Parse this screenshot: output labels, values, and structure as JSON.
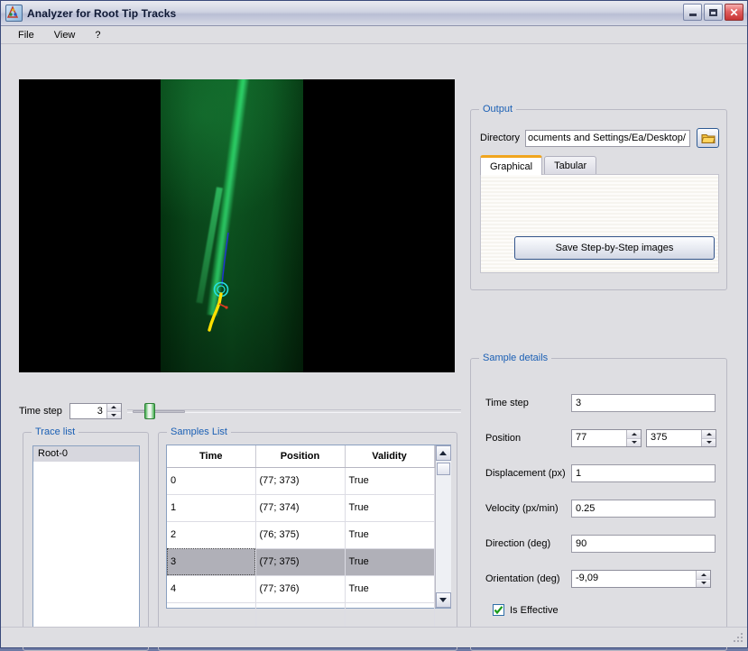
{
  "window": {
    "title": "Analyzer for Root Tip Tracks",
    "icon": "analyzer-app-icon",
    "controls": {
      "minimize": "minimize-button",
      "maximize": "maximize-button",
      "close": "close-button"
    }
  },
  "menu": {
    "items": [
      {
        "label": "File"
      },
      {
        "label": "View"
      },
      {
        "label": "?"
      }
    ]
  },
  "viewer": {
    "name": "root-tip-image",
    "marker_color": "#23e0e0",
    "track_color": "#ffe000",
    "path_color": "#2030d8"
  },
  "timestep": {
    "label": "Time step",
    "value": "3",
    "slider_name": "time-step-slider"
  },
  "trace_list": {
    "caption": "Trace list",
    "items": [
      {
        "label": "Root-0",
        "selected": true
      }
    ]
  },
  "samples_list": {
    "caption": "Samples List",
    "columns": [
      "Time",
      "Position",
      "Validity"
    ],
    "rows": [
      {
        "time": "0",
        "position": "(77; 373)",
        "validity": "True",
        "selected": false
      },
      {
        "time": "1",
        "position": "(77; 374)",
        "validity": "True",
        "selected": false
      },
      {
        "time": "2",
        "position": "(76; 375)",
        "validity": "True",
        "selected": false
      },
      {
        "time": "3",
        "position": "(77; 375)",
        "validity": "True",
        "selected": true
      },
      {
        "time": "4",
        "position": "(77; 376)",
        "validity": "True",
        "selected": false
      },
      {
        "time": "",
        "position": "",
        "validity": "",
        "selected": false
      }
    ]
  },
  "output": {
    "caption": "Output",
    "directory_label": "Directory",
    "directory_value": "ocuments and Settings/Ea/Desktop/",
    "browse_icon": "folder-icon",
    "tabs": [
      {
        "label": "Graphical",
        "active": true
      },
      {
        "label": "Tabular",
        "active": false
      }
    ],
    "save_button": "Save Step-by-Step images",
    "active_tab_accent": "#f0a51e"
  },
  "sample_details": {
    "caption": "Sample details",
    "time_step": {
      "label": "Time step",
      "value": "3"
    },
    "position": {
      "label": "Position",
      "x": "77",
      "y": "375"
    },
    "displacement": {
      "label": "Displacement (px)",
      "value": "1"
    },
    "velocity": {
      "label": "Velocity (px/min)",
      "value": "0.25"
    },
    "direction": {
      "label": "Direction (deg)",
      "value": "90"
    },
    "orientation": {
      "label": "Orientation (deg)",
      "value": "-9,09"
    },
    "is_effective": {
      "label": "Is Effective",
      "checked": true,
      "check_color": "#1a9a1a"
    }
  },
  "theme": {
    "background": "#dedee2",
    "group_caption": "#1a5fb4",
    "selection": "#b0b0b8"
  }
}
